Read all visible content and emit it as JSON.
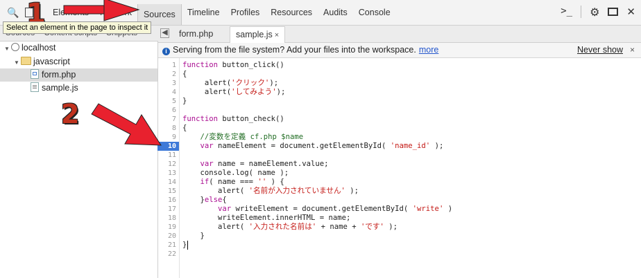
{
  "toolbar": {
    "tabs": [
      "Elements",
      "Network",
      "Sources",
      "Timeline",
      "Profiles",
      "Resources",
      "Audits",
      "Console"
    ],
    "active_tab": "Sources",
    "tooltip": "Select an element in the page to inspect it",
    "search_icon": "search-icon",
    "inspect_icon": "inspect-element-icon",
    "console_icon": "console-drawer-icon",
    "settings_icon": "gear-icon",
    "dock_icon": "dock-icon",
    "close_icon": "close-icon"
  },
  "navigator": {
    "tabs": [
      "Sources",
      "Content scripts",
      "Snippets"
    ],
    "tree": [
      {
        "label": "localhost",
        "type": "domain",
        "icon": "globe-icon"
      },
      {
        "label": "javascript",
        "type": "folder",
        "icon": "folder-icon"
      },
      {
        "label": "form.php",
        "type": "file",
        "icon": "html-file-icon",
        "selected": true
      },
      {
        "label": "sample.js",
        "type": "file",
        "icon": "js-file-icon"
      }
    ]
  },
  "file_tabs": [
    {
      "label": "form.php",
      "active": false
    },
    {
      "label": "sample.js",
      "active": true,
      "close": "×"
    }
  ],
  "infobar": {
    "message": "Serving from the file system? Add your files into the workspace.",
    "more": "more",
    "never_show": "Never show",
    "close": "×"
  },
  "editor": {
    "breakpoint_line": 10,
    "line_numbers": [
      "1",
      "2",
      "3",
      "4",
      "5",
      "6",
      "7",
      "8",
      "9",
      "10",
      "11",
      "12",
      "13",
      "14",
      "15",
      "16",
      "17",
      "18",
      "19",
      "20",
      "21",
      "22"
    ]
  },
  "annotations": {
    "badge_1": "1",
    "badge_2": "2",
    "arrow_color": "#e8212e"
  },
  "colors": {
    "keyword": "#aa0d91",
    "string": "#c41a16",
    "comment": "#236e25",
    "breakpoint": "#3d79d8"
  }
}
